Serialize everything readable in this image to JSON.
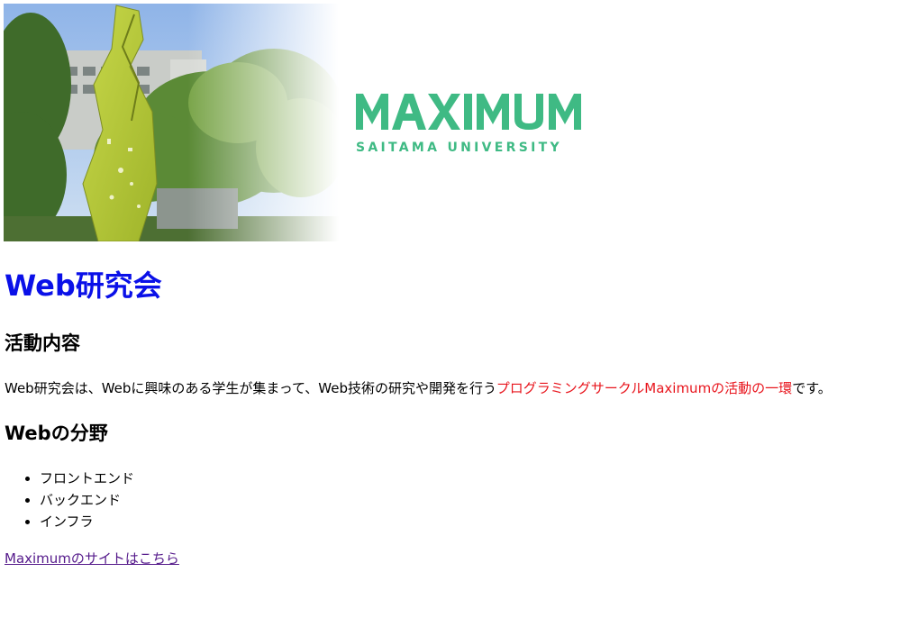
{
  "header": {
    "logo_title": "MAXIMUM",
    "logo_subtitle": "SAITAMA UNIVERSITY"
  },
  "main": {
    "title": "Web研究会",
    "section_activity_heading": "活動内容",
    "intro_before": "Web研究会は、Webに興味のある学生が集まって、Web技術の研究や開発を行う",
    "intro_highlight": "プログラミングサークルMaximumの活動の一環",
    "intro_after": "です。",
    "section_fields_heading": "Webの分野",
    "fields": [
      "フロントエンド",
      "バックエンド",
      "インフラ"
    ],
    "site_link_label": "Maximumのサイトはこちら"
  },
  "colors": {
    "title": "#0a10e8",
    "highlight": "#e8141c",
    "logo_green": "#3fba84",
    "visited_link": "#551a8b"
  },
  "icons": {
    "campus_photo": "campus-photo-image",
    "logo": "maximum-logo"
  }
}
